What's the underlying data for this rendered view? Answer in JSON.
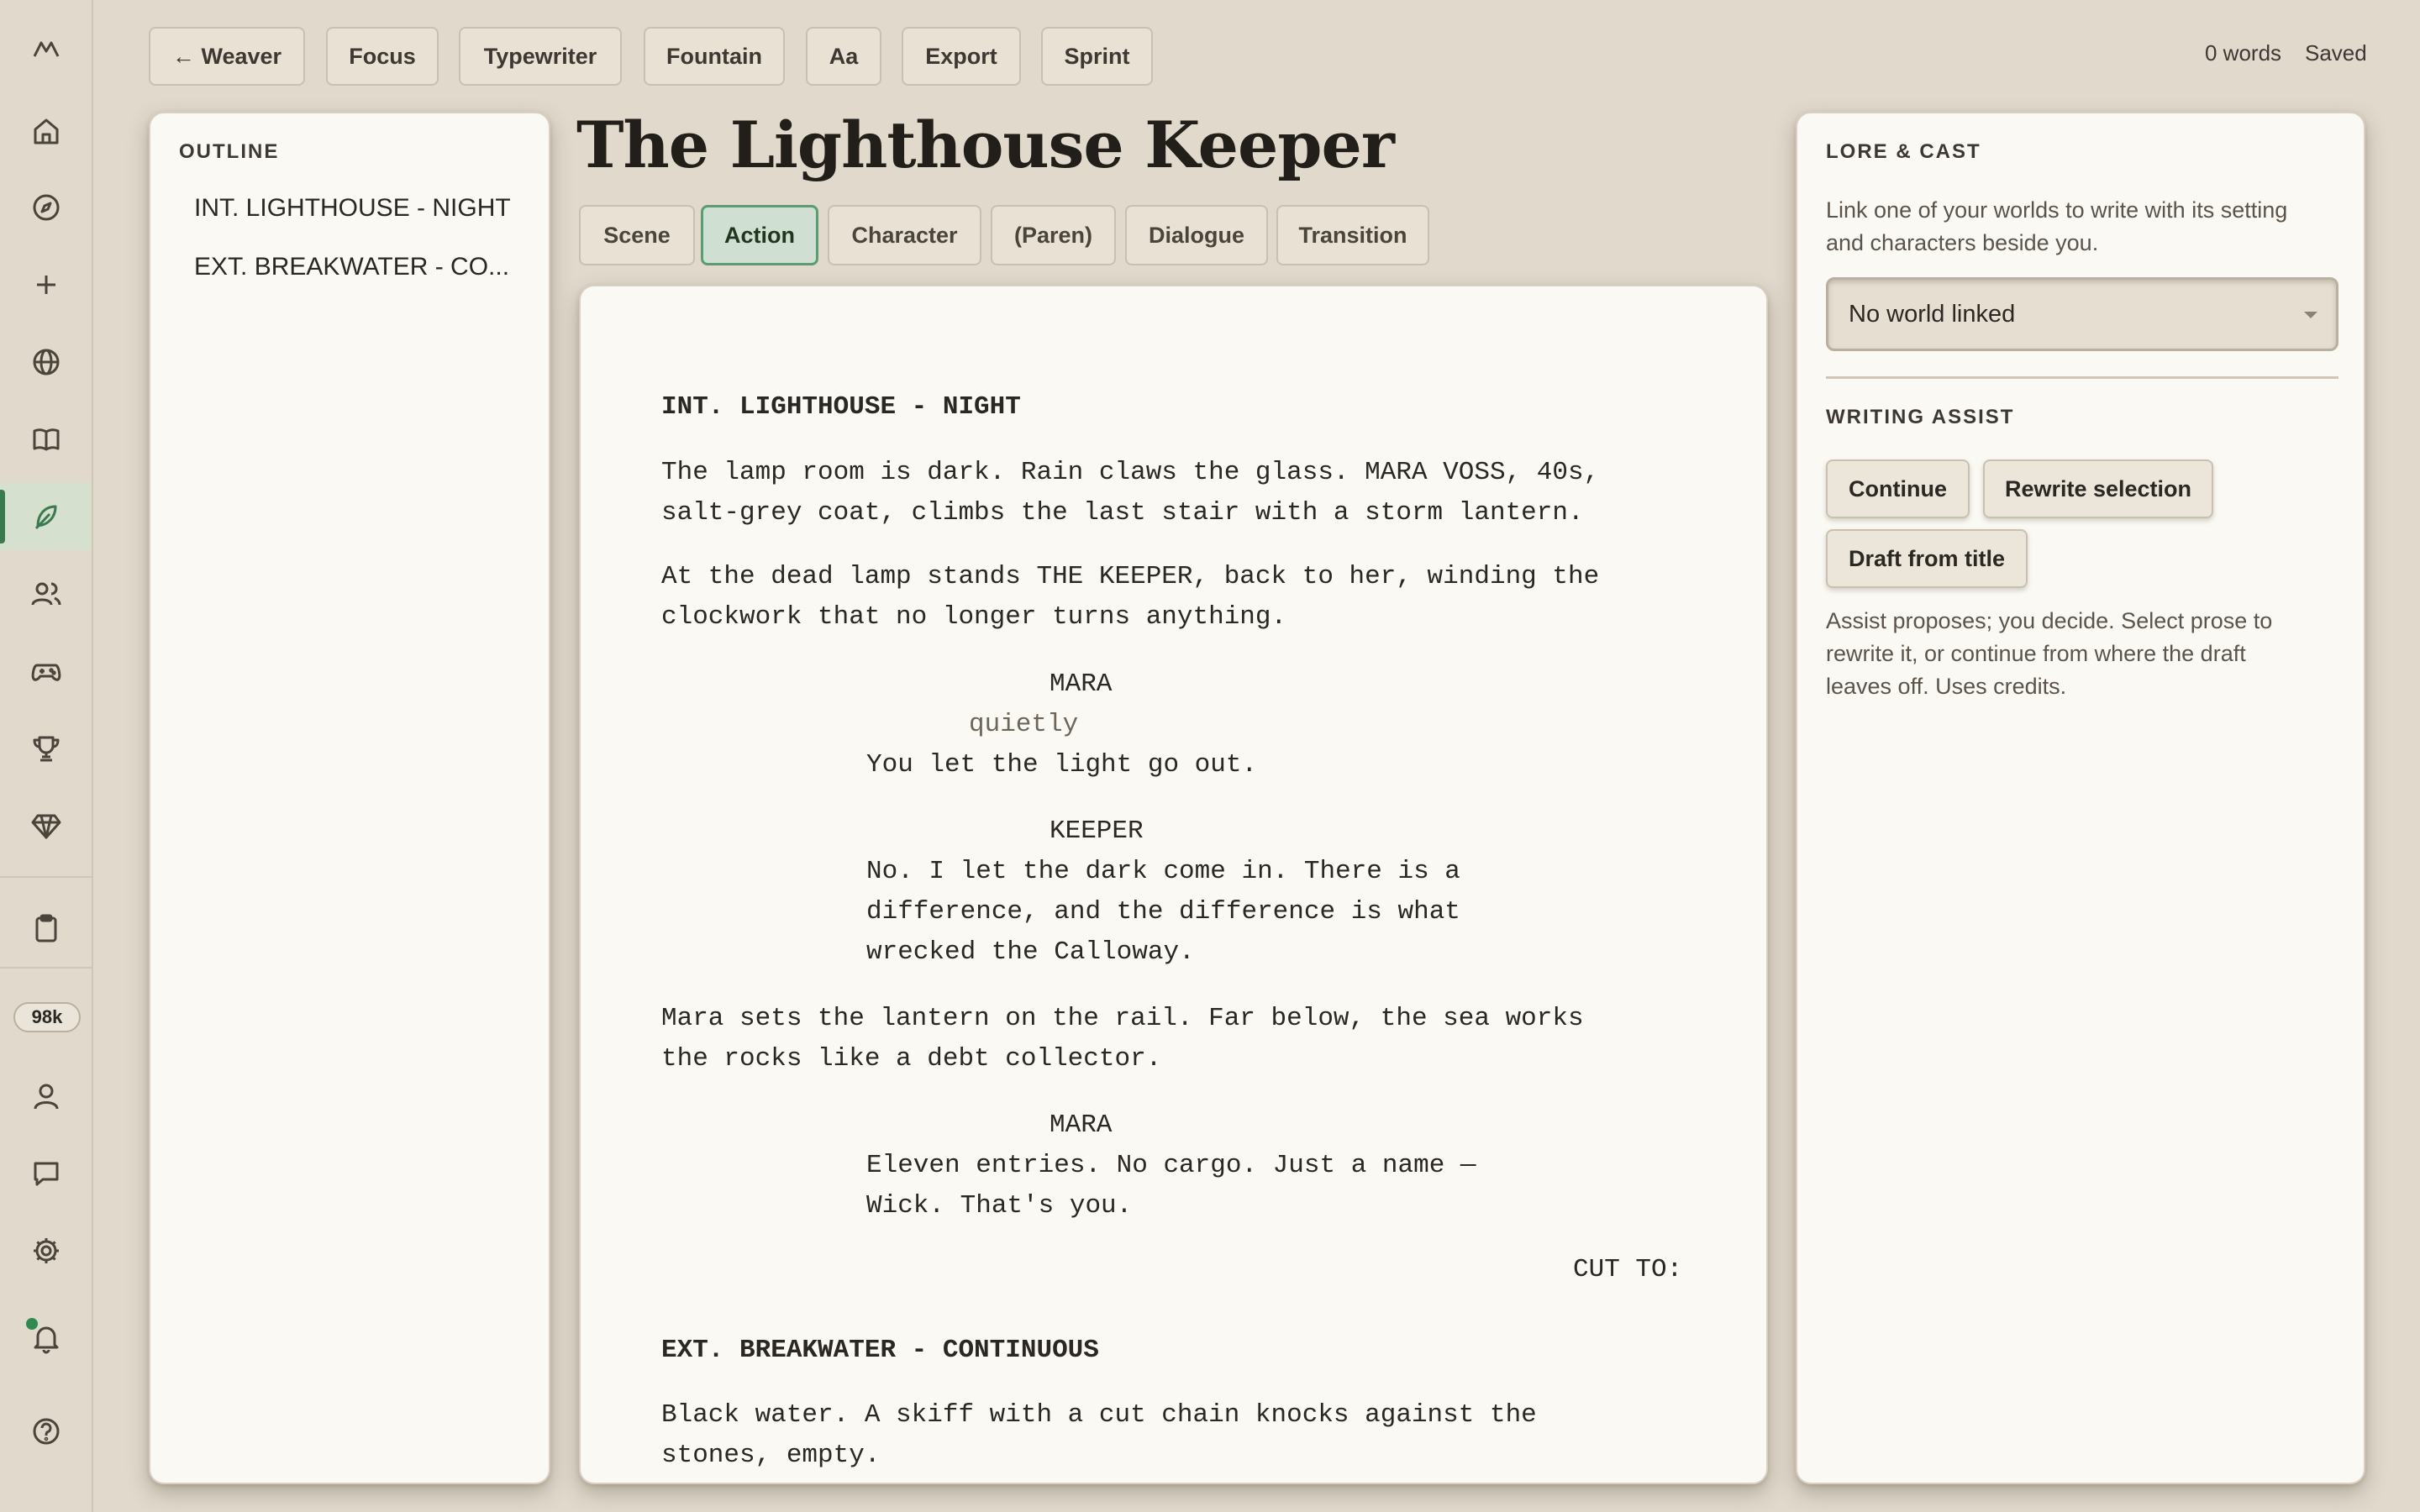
{
  "toolbar": {
    "back": "← Weaver",
    "focus": "Focus",
    "typewriter": "Typewriter",
    "fountain": "Fountain",
    "font": "Aa",
    "export": "Export",
    "sprint": "Sprint",
    "word_count": "0 words",
    "save_status": "Saved"
  },
  "rail": {
    "credits": "98k",
    "active_item": "screenplay",
    "accent": "#3a7a4e"
  },
  "outline": {
    "heading": "OUTLINE",
    "items": [
      "INT. LIGHTHOUSE - NIGHT",
      "EXT. BREAKWATER - CO..."
    ]
  },
  "document": {
    "title": "The Lighthouse Keeper",
    "element_types": [
      "Scene",
      "Action",
      "Character",
      "(Paren)",
      "Dialogue",
      "Transition"
    ],
    "selected_type": "Action"
  },
  "screenplay": {
    "scene1": "INT. LIGHTHOUSE - NIGHT",
    "action1_l1": "The lamp room is dark. Rain claws the glass. MARA VOSS, 40s,",
    "action1_l2": "salt-grey coat, climbs the last stair with a storm lantern.",
    "action2_l1": "At the dead lamp stands THE KEEPER, back to her, winding the",
    "action2_l2": "clockwork that no longer turns anything.",
    "char1": "MARA",
    "paren1": "quietly",
    "dialogue1": "You let the light go out.",
    "char2": "KEEPER",
    "dialogue2_l1": "No. I let the dark come in. There is a",
    "dialogue2_l2": "difference, and the difference is what",
    "dialogue2_l3": "wrecked the Calloway.",
    "action3_l1": "Mara sets the lantern on the rail. Far below, the sea works",
    "action3_l2": "the rocks like a debt collector.",
    "char3": "MARA",
    "dialogue3_l1": "Eleven entries. No cargo. Just a name —",
    "dialogue3_l2": "Wick. That's you.",
    "transition1": "CUT TO:",
    "scene2": "EXT. BREAKWATER - CONTINUOUS",
    "action4_l1": "Black water. A skiff with a cut chain knocks against the",
    "action4_l2": "stones, empty."
  },
  "lore": {
    "heading": "LORE & CAST",
    "description_l1": "Link one of your worlds to write with its setting",
    "description_l2": "and characters beside you.",
    "world_select_value": "No world linked"
  },
  "assist": {
    "heading": "WRITING ASSIST",
    "continue": "Continue",
    "rewrite": "Rewrite selection",
    "draft": "Draft from title",
    "note_l1": "Assist proposes; you decide. Select prose to",
    "note_l2": "rewrite it, or continue from where the draft",
    "note_l3": "leaves off. Uses credits."
  }
}
